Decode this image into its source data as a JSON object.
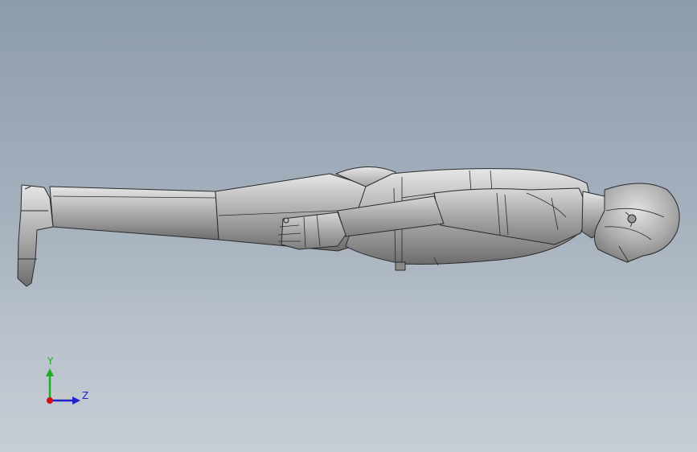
{
  "triad": {
    "y_label": "Y",
    "z_label": "Z",
    "colors": {
      "y_axis": "#1fae1f",
      "z_axis": "#2222cc",
      "x_axis": "#cc1111"
    }
  },
  "model": {
    "fill": "#a9a9a9",
    "edge": "#2a2a2a"
  }
}
